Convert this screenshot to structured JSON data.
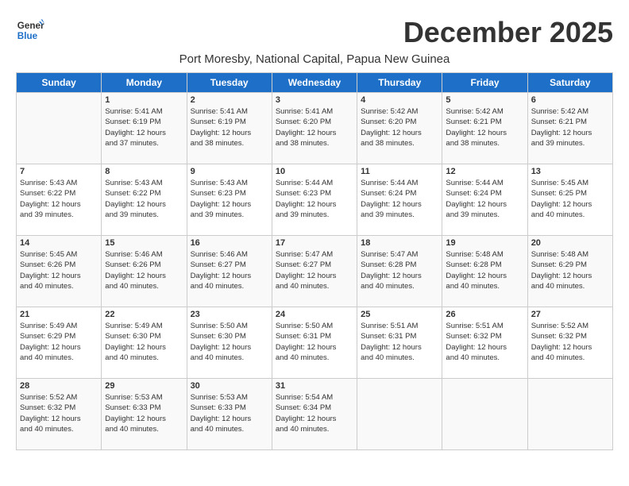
{
  "header": {
    "logo_line1": "General",
    "logo_line2": "Blue",
    "month_title": "December 2025",
    "location": "Port Moresby, National Capital, Papua New Guinea"
  },
  "weekdays": [
    "Sunday",
    "Monday",
    "Tuesday",
    "Wednesday",
    "Thursday",
    "Friday",
    "Saturday"
  ],
  "weeks": [
    [
      {
        "day": "",
        "info": ""
      },
      {
        "day": "1",
        "info": "Sunrise: 5:41 AM\nSunset: 6:19 PM\nDaylight: 12 hours\nand 37 minutes."
      },
      {
        "day": "2",
        "info": "Sunrise: 5:41 AM\nSunset: 6:19 PM\nDaylight: 12 hours\nand 38 minutes."
      },
      {
        "day": "3",
        "info": "Sunrise: 5:41 AM\nSunset: 6:20 PM\nDaylight: 12 hours\nand 38 minutes."
      },
      {
        "day": "4",
        "info": "Sunrise: 5:42 AM\nSunset: 6:20 PM\nDaylight: 12 hours\nand 38 minutes."
      },
      {
        "day": "5",
        "info": "Sunrise: 5:42 AM\nSunset: 6:21 PM\nDaylight: 12 hours\nand 38 minutes."
      },
      {
        "day": "6",
        "info": "Sunrise: 5:42 AM\nSunset: 6:21 PM\nDaylight: 12 hours\nand 39 minutes."
      }
    ],
    [
      {
        "day": "7",
        "info": "Sunrise: 5:43 AM\nSunset: 6:22 PM\nDaylight: 12 hours\nand 39 minutes."
      },
      {
        "day": "8",
        "info": "Sunrise: 5:43 AM\nSunset: 6:22 PM\nDaylight: 12 hours\nand 39 minutes."
      },
      {
        "day": "9",
        "info": "Sunrise: 5:43 AM\nSunset: 6:23 PM\nDaylight: 12 hours\nand 39 minutes."
      },
      {
        "day": "10",
        "info": "Sunrise: 5:44 AM\nSunset: 6:23 PM\nDaylight: 12 hours\nand 39 minutes."
      },
      {
        "day": "11",
        "info": "Sunrise: 5:44 AM\nSunset: 6:24 PM\nDaylight: 12 hours\nand 39 minutes."
      },
      {
        "day": "12",
        "info": "Sunrise: 5:44 AM\nSunset: 6:24 PM\nDaylight: 12 hours\nand 39 minutes."
      },
      {
        "day": "13",
        "info": "Sunrise: 5:45 AM\nSunset: 6:25 PM\nDaylight: 12 hours\nand 40 minutes."
      }
    ],
    [
      {
        "day": "14",
        "info": "Sunrise: 5:45 AM\nSunset: 6:26 PM\nDaylight: 12 hours\nand 40 minutes."
      },
      {
        "day": "15",
        "info": "Sunrise: 5:46 AM\nSunset: 6:26 PM\nDaylight: 12 hours\nand 40 minutes."
      },
      {
        "day": "16",
        "info": "Sunrise: 5:46 AM\nSunset: 6:27 PM\nDaylight: 12 hours\nand 40 minutes."
      },
      {
        "day": "17",
        "info": "Sunrise: 5:47 AM\nSunset: 6:27 PM\nDaylight: 12 hours\nand 40 minutes."
      },
      {
        "day": "18",
        "info": "Sunrise: 5:47 AM\nSunset: 6:28 PM\nDaylight: 12 hours\nand 40 minutes."
      },
      {
        "day": "19",
        "info": "Sunrise: 5:48 AM\nSunset: 6:28 PM\nDaylight: 12 hours\nand 40 minutes."
      },
      {
        "day": "20",
        "info": "Sunrise: 5:48 AM\nSunset: 6:29 PM\nDaylight: 12 hours\nand 40 minutes."
      }
    ],
    [
      {
        "day": "21",
        "info": "Sunrise: 5:49 AM\nSunset: 6:29 PM\nDaylight: 12 hours\nand 40 minutes."
      },
      {
        "day": "22",
        "info": "Sunrise: 5:49 AM\nSunset: 6:30 PM\nDaylight: 12 hours\nand 40 minutes."
      },
      {
        "day": "23",
        "info": "Sunrise: 5:50 AM\nSunset: 6:30 PM\nDaylight: 12 hours\nand 40 minutes."
      },
      {
        "day": "24",
        "info": "Sunrise: 5:50 AM\nSunset: 6:31 PM\nDaylight: 12 hours\nand 40 minutes."
      },
      {
        "day": "25",
        "info": "Sunrise: 5:51 AM\nSunset: 6:31 PM\nDaylight: 12 hours\nand 40 minutes."
      },
      {
        "day": "26",
        "info": "Sunrise: 5:51 AM\nSunset: 6:32 PM\nDaylight: 12 hours\nand 40 minutes."
      },
      {
        "day": "27",
        "info": "Sunrise: 5:52 AM\nSunset: 6:32 PM\nDaylight: 12 hours\nand 40 minutes."
      }
    ],
    [
      {
        "day": "28",
        "info": "Sunrise: 5:52 AM\nSunset: 6:32 PM\nDaylight: 12 hours\nand 40 minutes."
      },
      {
        "day": "29",
        "info": "Sunrise: 5:53 AM\nSunset: 6:33 PM\nDaylight: 12 hours\nand 40 minutes."
      },
      {
        "day": "30",
        "info": "Sunrise: 5:53 AM\nSunset: 6:33 PM\nDaylight: 12 hours\nand 40 minutes."
      },
      {
        "day": "31",
        "info": "Sunrise: 5:54 AM\nSunset: 6:34 PM\nDaylight: 12 hours\nand 40 minutes."
      },
      {
        "day": "",
        "info": ""
      },
      {
        "day": "",
        "info": ""
      },
      {
        "day": "",
        "info": ""
      }
    ]
  ]
}
